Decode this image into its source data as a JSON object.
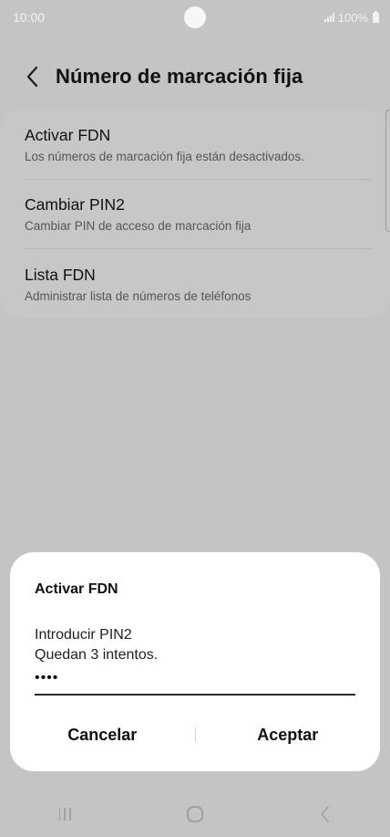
{
  "status_bar": {
    "time": "10:00",
    "battery": "100%",
    "icons": [
      "signal-icon",
      "battery-icon"
    ]
  },
  "header": {
    "back_icon": "chevron-left-icon",
    "title": "Número de marcación fija"
  },
  "settings": {
    "items": [
      {
        "title": "Activar FDN",
        "subtitle": "Los números de marcación fija están desactivados."
      },
      {
        "title": "Cambiar PIN2",
        "subtitle": "Cambiar PIN de acceso de marcación fija"
      },
      {
        "title": "Lista FDN",
        "subtitle": "Administrar lista de números de teléfonos"
      }
    ]
  },
  "dialog": {
    "title": "Activar FDN",
    "message_line1": "Introducir PIN2",
    "message_line2": "Quedan 3 intentos.",
    "pin_value": "••••",
    "cancel_label": "Cancelar",
    "accept_label": "Aceptar"
  },
  "nav_bar": {
    "icons": [
      "recents-icon",
      "home-icon",
      "back-icon"
    ]
  },
  "colors": {
    "overlay_background": "#c4c4c4",
    "dialog_background": "#ffffff",
    "text_primary": "#111111",
    "text_secondary": "#555555"
  }
}
